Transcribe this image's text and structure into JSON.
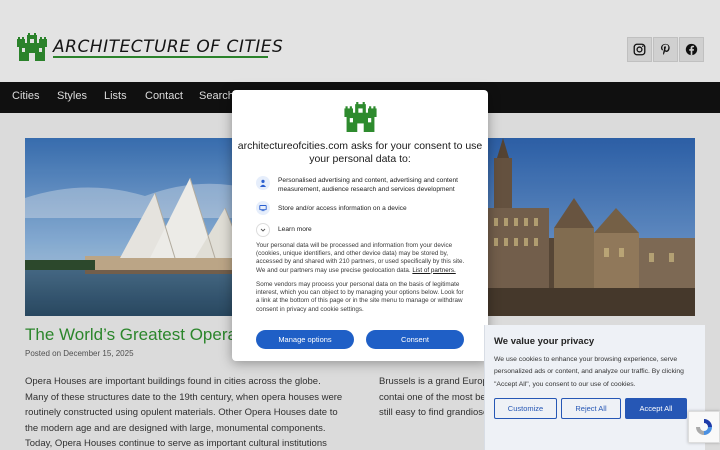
{
  "site": {
    "title": "ARCHITECTURE OF CITIES",
    "social": [
      {
        "icon": "instagram-icon"
      },
      {
        "icon": "pinterest-icon"
      },
      {
        "icon": "facebook-icon"
      }
    ]
  },
  "nav": {
    "items": [
      "Cities",
      "Styles",
      "Lists",
      "Contact",
      "Search"
    ]
  },
  "post": {
    "title": "The World’s Greatest Opera H",
    "date": "Posted on December 15, 2025",
    "excerpt": "Opera Houses are important buildings found in cities across the globe. Many of these structures date to the 19th century, when opera houses were routinely constructed using opulent materials. Other Opera Houses date to the modern age and are designed with large, monumental components. Today, Opera Houses continue to serve as important cultural institutions that showcase art"
  },
  "post2": {
    "excerpt": "Brussels is a grand Europe Middle Ages. It’s home to a buildings. Brussels contai one of the most beautiful s Brussels has a very metropolitan feel, it’s still easy to find grandiose squares."
  },
  "consent": {
    "title": "architectureofcities.com asks for your consent to use your personal data to:",
    "purposes": [
      {
        "icon": "person-icon",
        "text": "Personalised advertising and content, advertising and content measurement, audience research and services development"
      },
      {
        "icon": "device-icon",
        "text": "Store and/or access information on a device"
      }
    ],
    "learn_more": "Learn more",
    "body1": "Your personal data will be processed and information from your device (cookies, unique identifiers, and other device data) may be stored by, accessed by and shared with 210 partners, or used specifically by this site. We and our partners may use precise geolocation data.",
    "partners_link": "List of partners.",
    "body2": "Some vendors may process your personal data on the basis of legitimate interest, which you can object to by managing your options below. Look for a link at the bottom of this page or in the site menu to manage or withdraw consent in privacy and cookie settings.",
    "manage_label": "Manage options",
    "consent_label": "Consent"
  },
  "cookie_banner": {
    "title": "We value your privacy",
    "text": "We use cookies to enhance your browsing experience, serve personalized ads or content, and analyze our traffic. By clicking \"Accept All\", you consent to our use of cookies.",
    "customize_label": "Customize",
    "reject_label": "Reject All",
    "accept_label": "Accept All"
  },
  "colors": {
    "accent_green": "#2f8f2f",
    "button_blue": "#1f5fc6",
    "nav_bg": "#121212"
  }
}
